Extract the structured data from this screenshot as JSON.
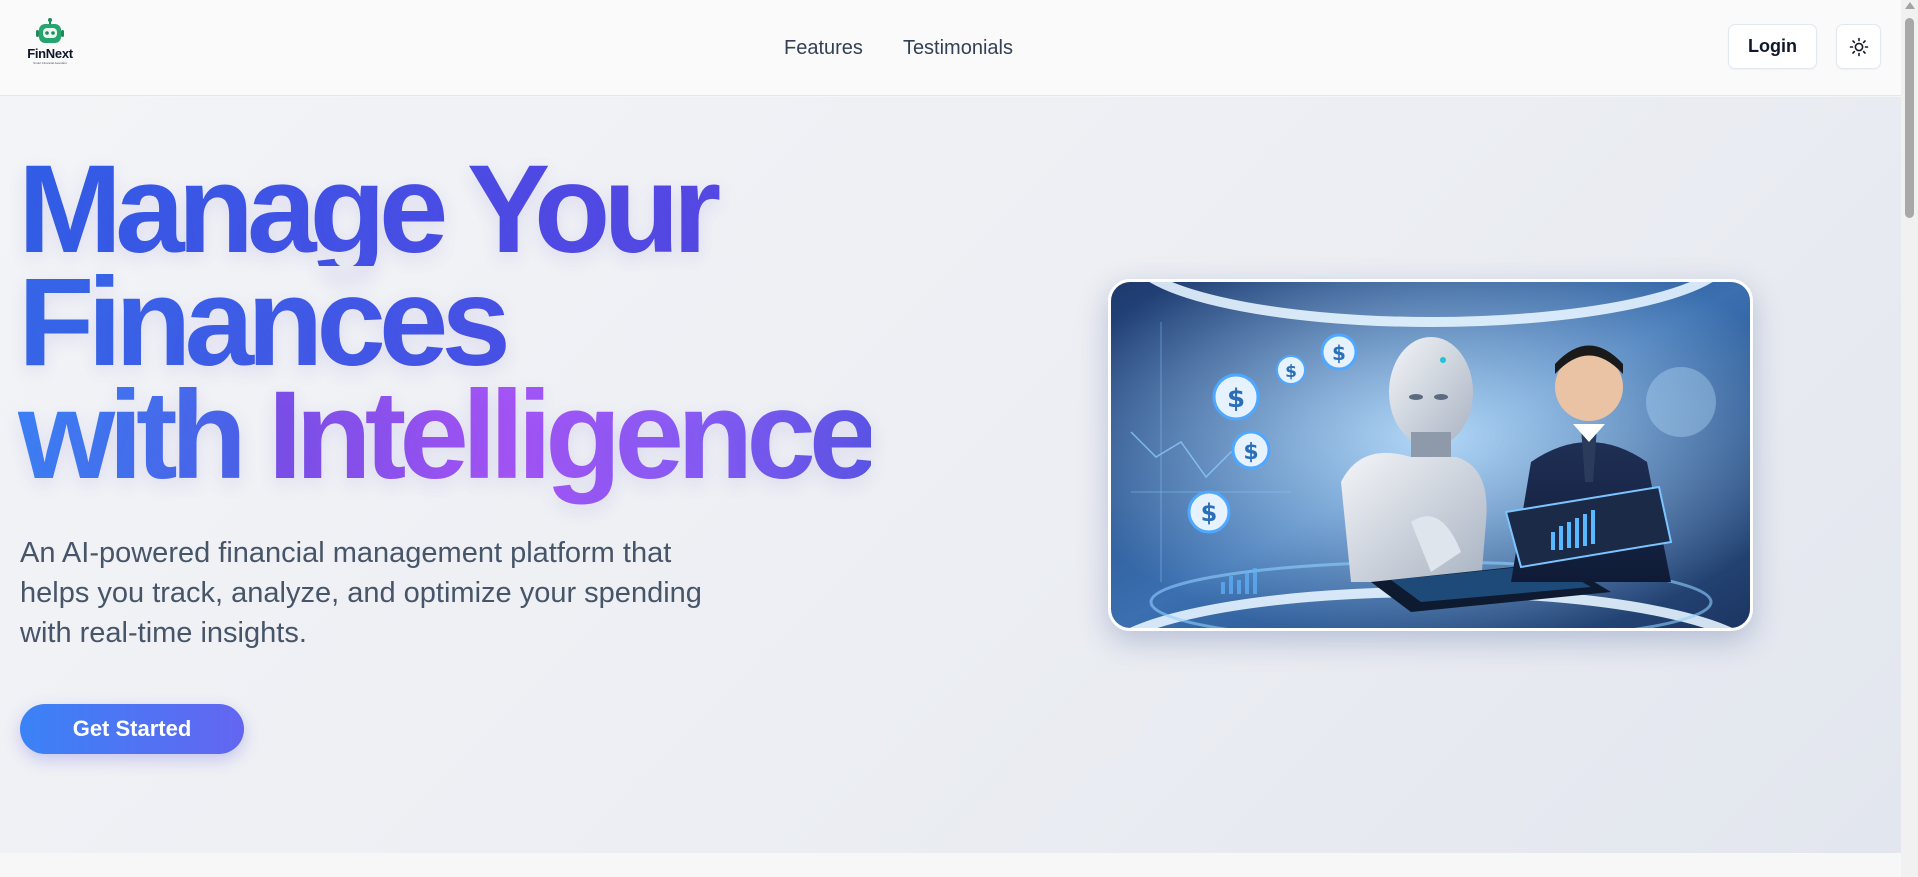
{
  "header": {
    "logo": {
      "name": "FinNext",
      "tagline": "Smart Financial Assistant",
      "icon": "robot-icon",
      "color": "#22a06b"
    },
    "nav": [
      {
        "label": "Features"
      },
      {
        "label": "Testimonials"
      }
    ],
    "login_label": "Login",
    "theme_icon": "sun-icon"
  },
  "hero": {
    "headline": {
      "line1": "Manage Your",
      "line2": "Finances",
      "line3_a": "with",
      "line3_b": "Intelligence"
    },
    "subtitle": "An AI-powered financial management platform that helps you track, analyze, and optimize your spending with real-time insights.",
    "cta_label": "Get Started",
    "image": {
      "subject": "robot-and-businessman-analyzing-finances",
      "alt": "AI robot and businessman reviewing financial data"
    }
  },
  "colors": {
    "accent_blue": "#3b82f6",
    "accent_indigo": "#6366f1",
    "accent_purple": "#a855f7"
  }
}
